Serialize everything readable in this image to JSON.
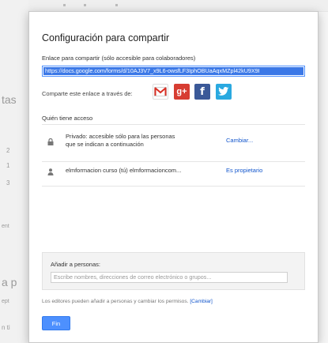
{
  "background": {
    "fragments": [
      "tas",
      "2",
      "1",
      "3",
      "ent",
      "a p",
      "ept",
      "n ti"
    ]
  },
  "dialog": {
    "title": "Configuración para compartir",
    "link_label": "Enlace para compartir (sólo accesible para colaboradores)",
    "link_value": "https://docs.google.com/forms/d/10AJ3V7_x9L6-owsfLF3IphOBUaAqxMZpl42kU9X9I",
    "share_label": "Comparte este enlace a través de:",
    "share_icons": [
      {
        "name": "gmail-icon",
        "glyph": "M",
        "color": "#d93025"
      },
      {
        "name": "google-plus-icon",
        "glyph": "g+",
        "color": "#d73d32"
      },
      {
        "name": "facebook-icon",
        "glyph": "f",
        "color": "#3b5998"
      },
      {
        "name": "twitter-icon",
        "glyph": "t",
        "color": "#2aa9e0"
      }
    ],
    "access_title": "Quién tiene acceso",
    "access_rows": [
      {
        "icon": "lock-icon",
        "text_line1": "Privado: accesible sólo para las personas",
        "text_line2": "que se indican a continuación",
        "action": "Cambiar..."
      },
      {
        "icon": "person-icon",
        "text_line1": "elmformacion curso (tú)  elmformacioncom...",
        "action": "Es propietario"
      }
    ],
    "add_people": {
      "label": "Añadir a personas:",
      "placeholder": "Escribe nombres, direcciones de correo electrónico o grupos..."
    },
    "editors_note": "Los editores pueden añadir a personas y cambiar los permisos.",
    "editors_note_link": "[Cambiar]",
    "done_label": "Fin"
  }
}
